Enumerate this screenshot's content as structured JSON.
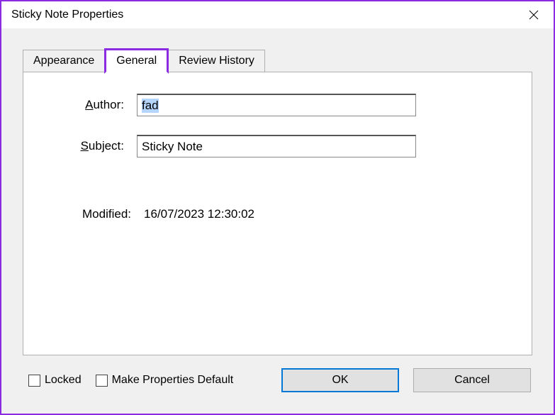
{
  "window": {
    "title": "Sticky Note Properties"
  },
  "tabs": {
    "appearance": "Appearance",
    "general": "General",
    "review_history": "Review History"
  },
  "form": {
    "author_label_pre": "A",
    "author_label_post": "uthor:",
    "author_value": "fad",
    "subject_label_pre": "S",
    "subject_label_post": "ubject:",
    "subject_value": "Sticky Note",
    "modified_label": "Modified:",
    "modified_value": "16/07/2023 12:30:02"
  },
  "bottom": {
    "locked_label": "Locked",
    "make_default_label": "Make Properties Default",
    "ok_label": "OK",
    "cancel_label": "Cancel"
  }
}
